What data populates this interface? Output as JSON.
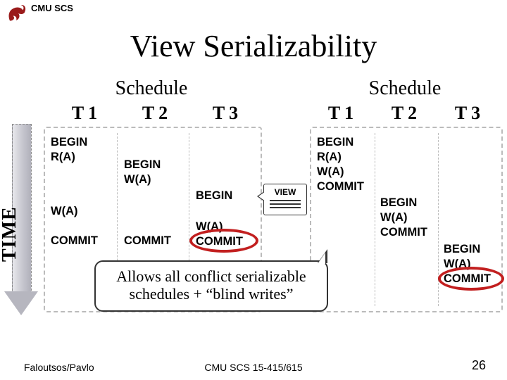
{
  "header": {
    "org": "CMU SCS"
  },
  "title": "View Serializability",
  "time_label": "TIME",
  "schedule_label": "Schedule",
  "columns": {
    "t1": "T 1",
    "t2": "T 2",
    "t3": "T 3"
  },
  "left": {
    "t1": {
      "l1": "BEGIN",
      "l2": "R(A)",
      "l3": "W(A)",
      "l4": "COMMIT"
    },
    "t2": {
      "l1": "BEGIN",
      "l2": "W(A)",
      "l3": "COMMIT"
    },
    "t3": {
      "l1": "BEGIN",
      "l2": "W(A)",
      "l3": "COMMIT"
    }
  },
  "right": {
    "t1": {
      "l1": "BEGIN",
      "l2": "R(A)",
      "l3": "W(A)",
      "l4": "COMMIT"
    },
    "t2": {
      "l1": "BEGIN",
      "l2": "W(A)",
      "l3": "COMMIT"
    },
    "t3": {
      "l1": "BEGIN",
      "l2": "W(A)",
      "l3": "COMMIT"
    }
  },
  "view_badge": "VIEW",
  "bubble": "Allows all conflict serializable schedules + “blind writes”",
  "footer": {
    "left": "Faloutsos/Pavlo",
    "center": "CMU SCS 15-415/615",
    "right": "26"
  }
}
